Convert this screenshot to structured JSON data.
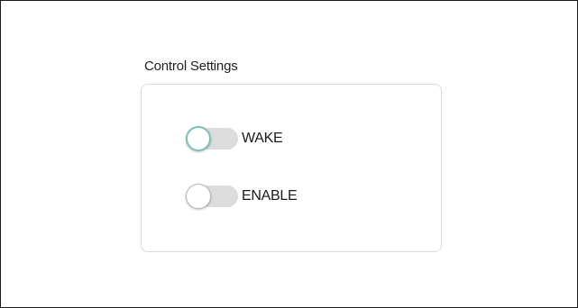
{
  "panel": {
    "title": "Control Settings"
  },
  "toggles": [
    {
      "label": "WAKE",
      "state": "off",
      "focused": true
    },
    {
      "label": "ENABLE",
      "state": "off",
      "focused": false
    }
  ],
  "colors": {
    "track_off": "#dcdcdc",
    "focus_ring": "#7fbfb8",
    "group_border": "#d9d9d9"
  }
}
